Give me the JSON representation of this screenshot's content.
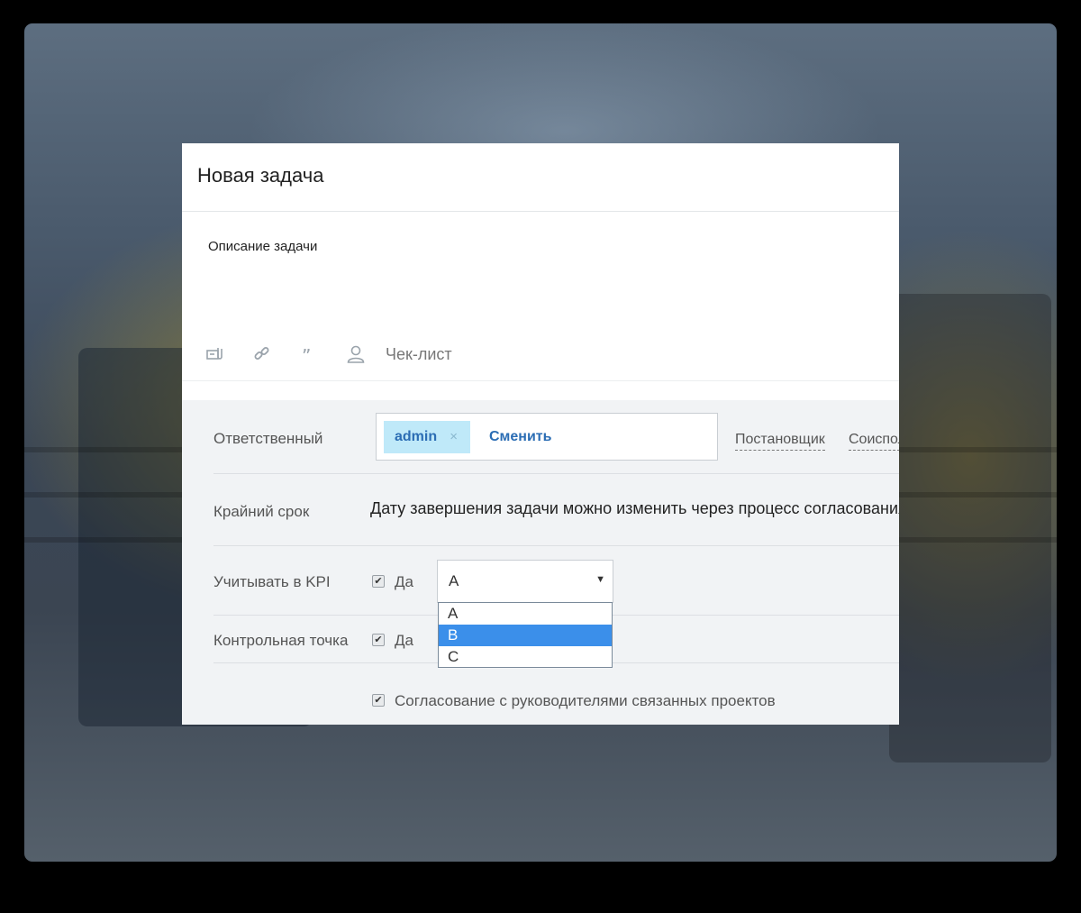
{
  "modal": {
    "title": "Новая задача",
    "description_label": "Описание задачи",
    "toolbar": {
      "icons": [
        "attach-icon",
        "link-icon",
        "quote-icon",
        "user-icon"
      ],
      "checklist_label": "Чек-лист"
    }
  },
  "form": {
    "responsible": {
      "label": "Ответственный",
      "chip_value": "admin",
      "chip_remove": "×",
      "change_label": "Сменить",
      "setter_link": "Постановщик",
      "coexecutor_link": "Соисполнители"
    },
    "deadline": {
      "label": "Крайний срок",
      "text": "Дату завершения задачи можно изменить через процесс согласования"
    },
    "kpi": {
      "label": "Учитывать в KPI",
      "checkbox_label": "Да",
      "checked": true,
      "select_value": "A",
      "options": [
        "A",
        "B",
        "C"
      ],
      "highlighted_option": "B"
    },
    "checkpoint": {
      "label": "Контрольная точка",
      "checkbox_label": "Да",
      "checked": true
    },
    "approval": {
      "checkbox_label": "Согласование с руководителями связанных проектов",
      "checked": true
    }
  },
  "colors": {
    "accent_link": "#2b6db4",
    "chip_bg": "#bfe9f9",
    "option_highlight": "#3b8fea"
  }
}
